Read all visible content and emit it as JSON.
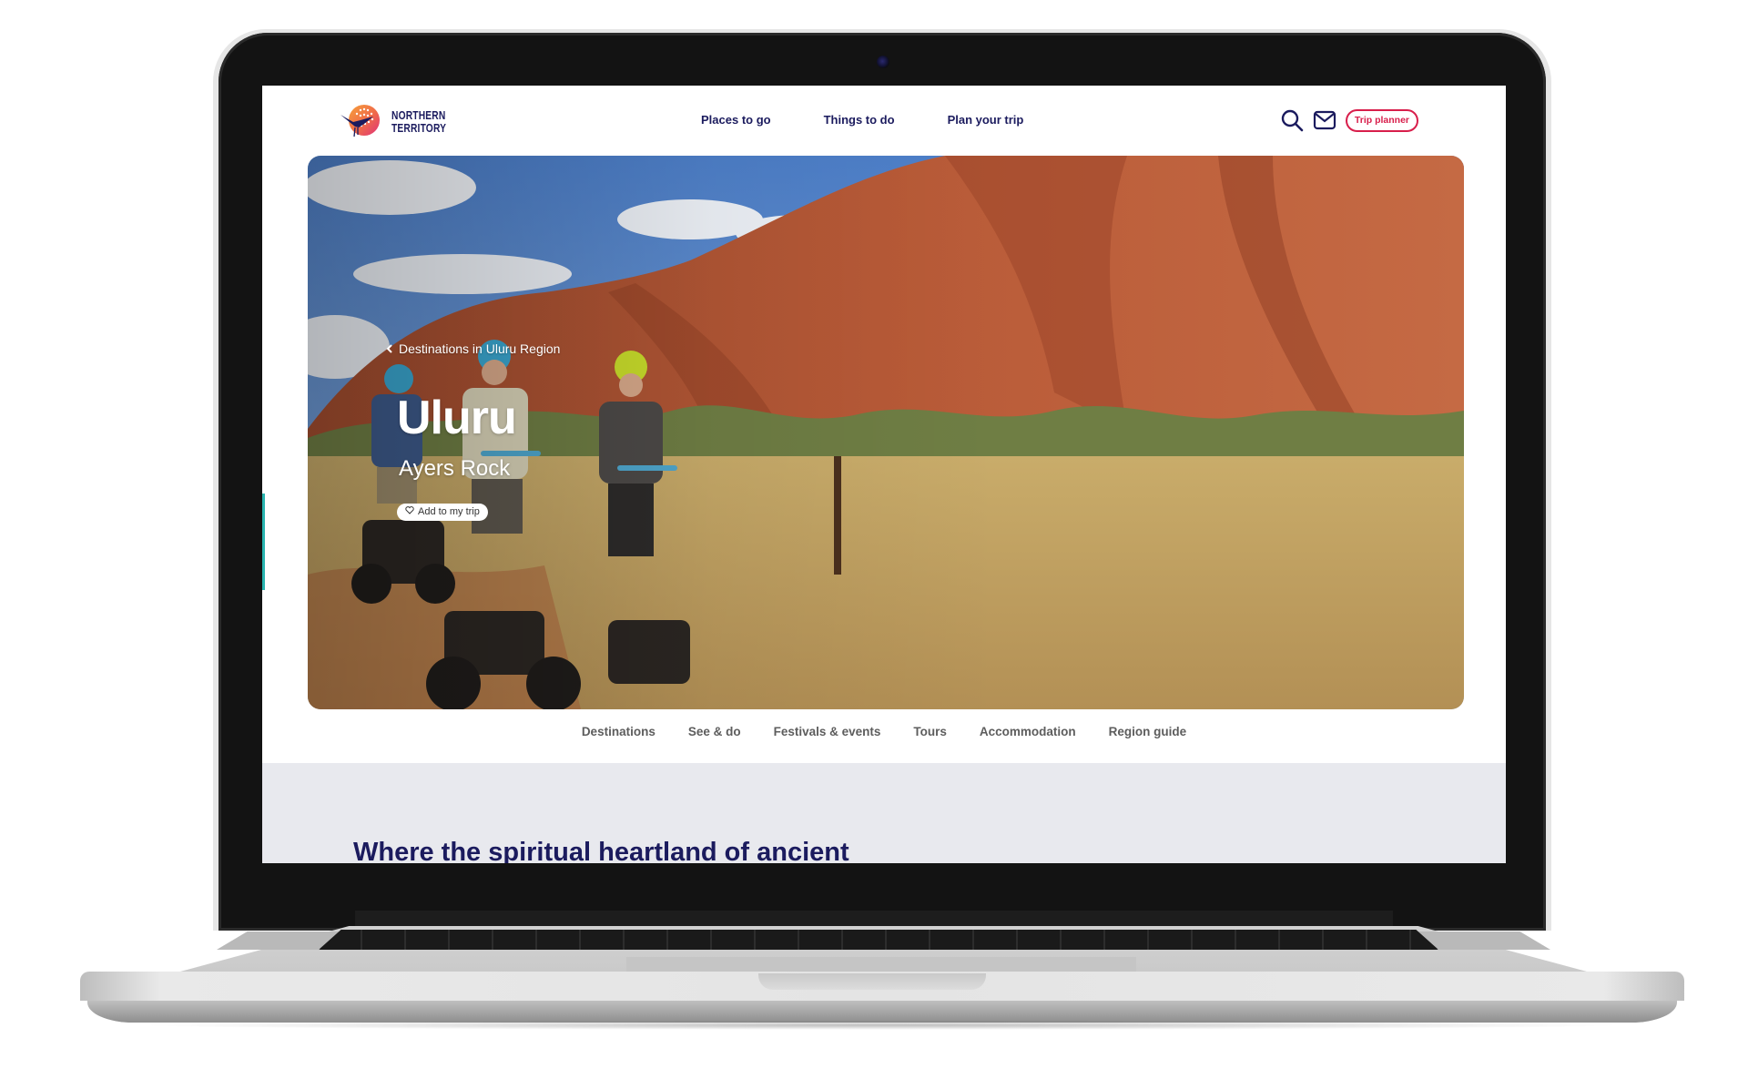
{
  "site": {
    "brand": {
      "line1": "NORTHERN",
      "line2": "TERRITORY"
    },
    "nav": [
      {
        "label": "Places to go"
      },
      {
        "label": "Things to do"
      },
      {
        "label": "Plan your trip"
      }
    ],
    "tools": {
      "search_icon": "search-icon",
      "mail_icon": "mail-icon",
      "trip_planner_label": "Trip planner"
    },
    "colors": {
      "navy": "#1b1b5e",
      "accent_red": "#d81e4b",
      "feedback_teal": "#2ab5b0",
      "section_bg": "#e8e9ee"
    }
  },
  "hero": {
    "breadcrumb": {
      "icon": "chevron-left-icon",
      "label": "Destinations in Uluru Region"
    },
    "title": "Uluru",
    "subtitle": "Ayers Rock",
    "add_to_trip": {
      "icon": "heart-icon",
      "label": "Add to my trip"
    }
  },
  "sub_nav": [
    {
      "label": "Destinations"
    },
    {
      "label": "See & do"
    },
    {
      "label": "Festivals & events"
    },
    {
      "label": "Tours"
    },
    {
      "label": "Accommodation"
    },
    {
      "label": "Region guide"
    }
  ],
  "intro": {
    "heading": "Where the spiritual heartland of ancient"
  }
}
